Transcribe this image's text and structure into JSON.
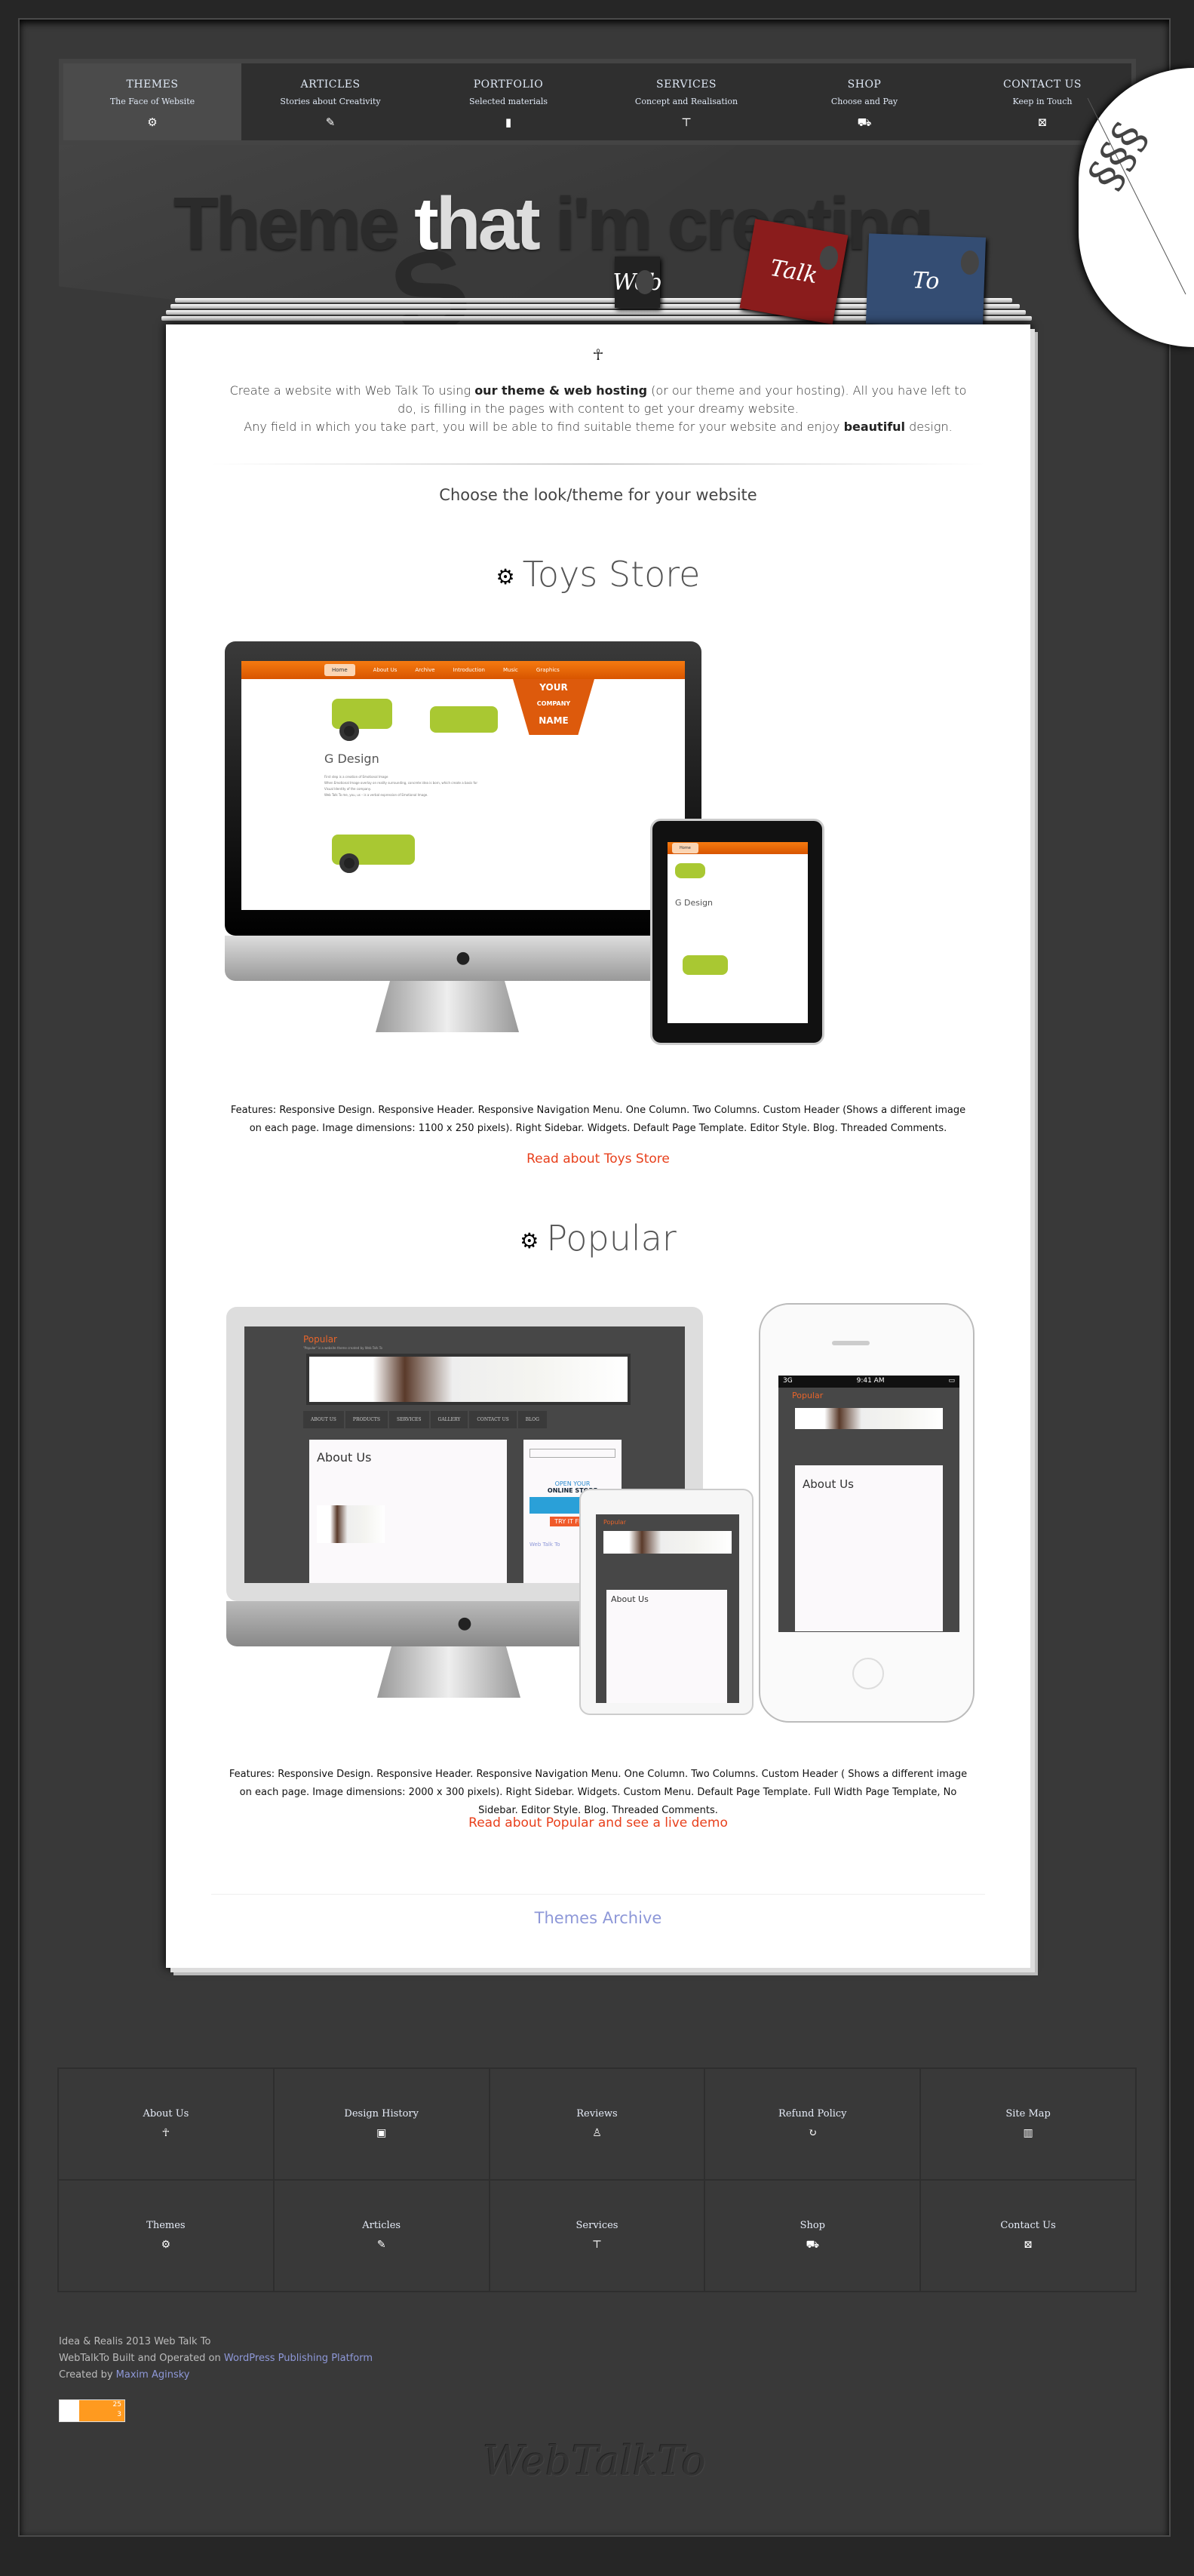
{
  "nav": {
    "items": [
      {
        "title": "THEMES",
        "subtitle": "The Face of Website",
        "icon": "gears-icon",
        "glyph": "⚙",
        "active": true
      },
      {
        "title": "ARTICLES",
        "subtitle": "Stories about Creativity",
        "icon": "pencil-icon",
        "glyph": "✎"
      },
      {
        "title": "PORTFOLIO",
        "subtitle": "Selected materials",
        "icon": "book-icon",
        "glyph": "▮"
      },
      {
        "title": "SERVICES",
        "subtitle": "Concept and Realisation",
        "icon": "paint-roller-icon",
        "glyph": "⊤"
      },
      {
        "title": "SHOP",
        "subtitle": "Choose and Pay",
        "icon": "cart-icon",
        "glyph": "⛟"
      },
      {
        "title": "CONTACT US",
        "subtitle": "Keep in Touch",
        "icon": "envelope-icon",
        "glyph": "⊠"
      }
    ]
  },
  "banner": {
    "word1": "Theme",
    "word2a": "t",
    "word2b": "hat",
    "word3": "i'm creating",
    "s_letter": "S",
    "tags": [
      {
        "label": "Web",
        "color": "#222222"
      },
      {
        "label": "Talk",
        "color": "#8a1c1c"
      },
      {
        "label": "To",
        "color": "#344d73"
      }
    ]
  },
  "intro": {
    "p1_a": "Create a website with Web Talk To using ",
    "p1_b": "our theme & web hosting",
    "p1_c": " (or our theme and your hosting). All you have left to do, is filling in the pages with content to get your dreamy website.",
    "p2_a": "Any field in which you take part, you will be able to find suitable theme for your website and enjoy ",
    "p2_b": "beautiful",
    "p2_c": " design."
  },
  "choose_title": "Choose the look/theme for your website",
  "themes": [
    {
      "name": "Toys Store",
      "features": "Features: Responsive Design. Responsive Header. Responsive Navigation Menu. One Column. Two Columns. Custom Header (Shows a different image on each page. Image dimensions: 1100 x 250 pixels). Right Sidebar. Widgets. Default Page Template. Editor Style. Blog. Threaded Comments.",
      "link": "Read about Toys Store",
      "mock": {
        "nav": [
          "Home",
          "About Us",
          "Archive",
          "Introduction",
          "Music",
          "Graphics"
        ],
        "logo1": "YOUR",
        "logo2": "COMPANY",
        "logo3": "NAME",
        "heading": "G Design",
        "p1": "First step is a creation of Emotional Image",
        "p2": "When Emotional Image overlay on reality surrounding, concrete idea is born, which create a basis for Visual Identity of the company.",
        "p3": "Web Talk To me, you, us – is a verbal expression of Emotional Image."
      }
    },
    {
      "name": "Popular",
      "features": "Features: Responsive Design. Responsive Header. Responsive Navigation Menu. One Column. Two Columns. Custom Header ( Shows a different image on each page. Image dimensions: 2000 x 300 pixels). Right Sidebar. Widgets. Custom Menu. Default Page Template. Full Width Page Template, No Sidebar. Editor Style. Blog. Threaded Comments.",
      "link": "Read about Popular and see a live demo",
      "mock": {
        "title": "Popular",
        "tagline": "\"Popular\" is a website theme created by Web Talk To",
        "nav": [
          "ABOUT US",
          "PRODUCTS",
          "SERVICES",
          "GALLERY",
          "CONTACT US",
          "BLOG"
        ],
        "heading": "About Us",
        "ad1": "OPEN YOUR",
        "ad2": "ONLINE STORE",
        "ad3": "TRY IT FREE",
        "widget": "Web Talk To",
        "status_carrier": "3G",
        "status_time": "9:41 AM"
      }
    }
  ],
  "archive_link": "Themes Archive",
  "footer": {
    "links": [
      {
        "label": "About Us",
        "icon": "person-icon",
        "glyph": "☥"
      },
      {
        "label": "Design History",
        "icon": "briefcase-icon",
        "glyph": "▣"
      },
      {
        "label": "Reviews",
        "icon": "microphone-icon",
        "glyph": "♙"
      },
      {
        "label": "Refund Policy",
        "icon": "refresh-icon",
        "glyph": "↻"
      },
      {
        "label": "Site Map",
        "icon": "map-icon",
        "glyph": "▥"
      },
      {
        "label": "Themes",
        "icon": "gears-icon",
        "glyph": "⚙"
      },
      {
        "label": "Articles",
        "icon": "pencil-icon",
        "glyph": "✎"
      },
      {
        "label": "Services",
        "icon": "paint-roller-icon",
        "glyph": "⊤"
      },
      {
        "label": "Shop",
        "icon": "cart-icon",
        "glyph": "⛟"
      },
      {
        "label": "Contact Us",
        "icon": "envelope-icon",
        "glyph": "⊠"
      }
    ],
    "line1": "Idea & Realis 2013 Web Talk To",
    "line2_a": "WebTalkTo Built and Operated on ",
    "line2_link": "WordPress Publishing Platform",
    "line3_a": "Created by ",
    "line3_link": "Maxim Aginsky",
    "badge_top": "25",
    "badge_bottom": "3",
    "watermark": "WebTalkTo"
  },
  "colors": {
    "accent_link": "#e8401c",
    "archive_link": "#8e98d8",
    "background": "#393939"
  }
}
